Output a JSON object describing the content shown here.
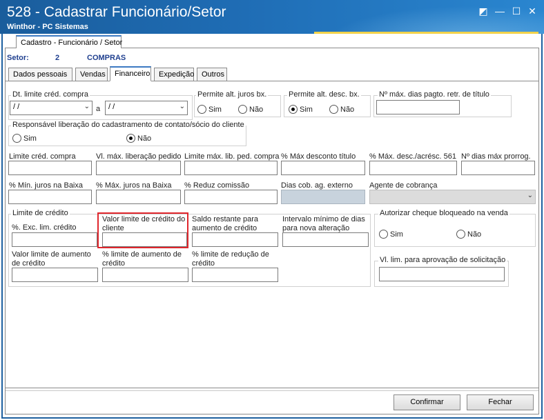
{
  "window": {
    "title": "528 - Cadastrar Funcionário/Setor",
    "subtitle": "Winthor - PC Sistemas",
    "controls": [
      "◩",
      "—",
      "☐",
      "✕"
    ]
  },
  "outer_tab": "Cadastro - Funcionário / Setor",
  "setor": {
    "label": "Setor:",
    "number": "2",
    "name": "COMPRAS"
  },
  "tabs": [
    "Dados pessoais",
    "Vendas",
    "Financeiro",
    "Expedição",
    "Outros"
  ],
  "active_tab": "Financeiro",
  "dt_limite": {
    "title": "Dt. limite créd. compra",
    "from": "/ /",
    "to": "/ /",
    "connector": "a"
  },
  "juros": {
    "title": "Permite alt. juros bx.",
    "sim": "Sim",
    "nao": "Não",
    "selected": "Não"
  },
  "desc": {
    "title": "Permite alt. desc. bx.",
    "sim": "Sim",
    "nao": "Não",
    "selected": "Sim"
  },
  "dias_pagto": {
    "label": "Nº máx. dias pagto. retr. de título",
    "value": ""
  },
  "responsavel": {
    "title": "Responsável liberação do cadastramento de contato/sócio do cliente",
    "sim": "Sim",
    "nao": "Não",
    "selected": "Não"
  },
  "row1": [
    {
      "label": "Limite créd. compra",
      "value": ""
    },
    {
      "label": "Vl. máx. liberação pedido",
      "value": ""
    },
    {
      "label": "Limite máx. lib. ped. compra",
      "value": ""
    },
    {
      "label": "% Máx desconto título",
      "value": ""
    },
    {
      "label": "% Máx. desc./acrésc. 561",
      "value": ""
    },
    {
      "label": "Nº dias máx prorrog.",
      "value": ""
    }
  ],
  "row2": [
    {
      "label": "% Mín. juros na Baixa",
      "value": ""
    },
    {
      "label": "% Máx. juros na Baixa",
      "value": ""
    },
    {
      "label": "% Reduz  comissão",
      "value": ""
    },
    {
      "label": "Dias cob. ag. externo",
      "value": ""
    },
    {
      "label": "Agente de cobrança",
      "value": ""
    }
  ],
  "limite_group": {
    "title": "Limite de crédito",
    "fields": [
      {
        "label": "%. Exc. lim. crédito",
        "value": ""
      },
      {
        "label": "Valor limite de crédito do cliente",
        "value": ""
      },
      {
        "label": "Saldo restante para aumento de crédito",
        "value": ""
      },
      {
        "label": "Intervalo mínimo de dias para nova alteração",
        "value": ""
      },
      {
        "label": "Valor limite de aumento de crédito",
        "value": ""
      },
      {
        "label": "% limite de aumento de crédito",
        "value": ""
      },
      {
        "label": "% limite de redução de crédito",
        "value": ""
      }
    ]
  },
  "cheque": {
    "title": "Autorizar cheque bloqueado na venda",
    "sim": "Sim",
    "nao": "Não",
    "selected": ""
  },
  "solicitacao": {
    "title": "Vl. lim. para aprovação de solicitação",
    "value": ""
  },
  "buttons": {
    "confirmar": "Confirmar",
    "fechar": "Fechar"
  },
  "colors": {
    "titlebar": "#1f6db5",
    "highlight": "#e0262c",
    "accent": "#f2d24a"
  }
}
